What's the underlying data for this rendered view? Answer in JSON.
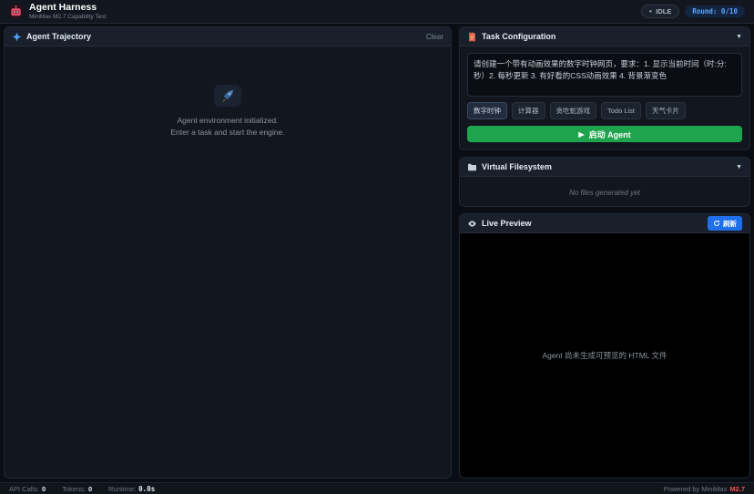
{
  "header": {
    "title": "Agent Harness",
    "subtitle": "MiniMax M2.7 Capability Test",
    "status_badge": "IDLE",
    "round_badge": "Round: 0/10"
  },
  "trajectory": {
    "title": "Agent Trajectory",
    "clear_label": "Clear",
    "empty_line1": "Agent environment initialized.",
    "empty_line2": "Enter a task and start the engine."
  },
  "task_config": {
    "title": "Task Configuration",
    "prompt_value": "请创建一个带有动画效果的数字时钟网页，要求：1. 显示当前时间（时:分:秒）2. 每秒更新 3. 有好看的CSS动画效果 4. 背景渐变色",
    "presets": [
      "数字时钟",
      "计算器",
      "贪吃蛇游戏",
      "Todo List",
      "天气卡片"
    ],
    "active_preset": "数字时钟",
    "start_label": "启动 Agent"
  },
  "filesystem": {
    "title": "Virtual Filesystem",
    "empty_text": "No files generated yet"
  },
  "preview": {
    "title": "Live Preview",
    "refresh_label": "刷新",
    "empty_text": "Agent 尚未生成可预览的 HTML 文件"
  },
  "footer": {
    "api_calls_label": "API Calls:",
    "api_calls_value": "0",
    "tokens_label": "Tokens:",
    "tokens_value": "0",
    "runtime_label": "Runtime:",
    "runtime_value": "0.0s",
    "powered_by": "Powered by MiniMax",
    "powered_model": "M2.7"
  },
  "icons": {
    "chevron_down": "▼",
    "play": "▶",
    "dot": "●"
  },
  "colors": {
    "page_bg": "#0a0e14",
    "panel_bg": "#12161f",
    "panel_header_bg": "#1a202b",
    "accent_green": "#1ea44c",
    "accent_blue": "#58a6ff",
    "refresh_blue": "#1f6feb",
    "model_red": "#f85149",
    "preview_bg": "#000000"
  }
}
